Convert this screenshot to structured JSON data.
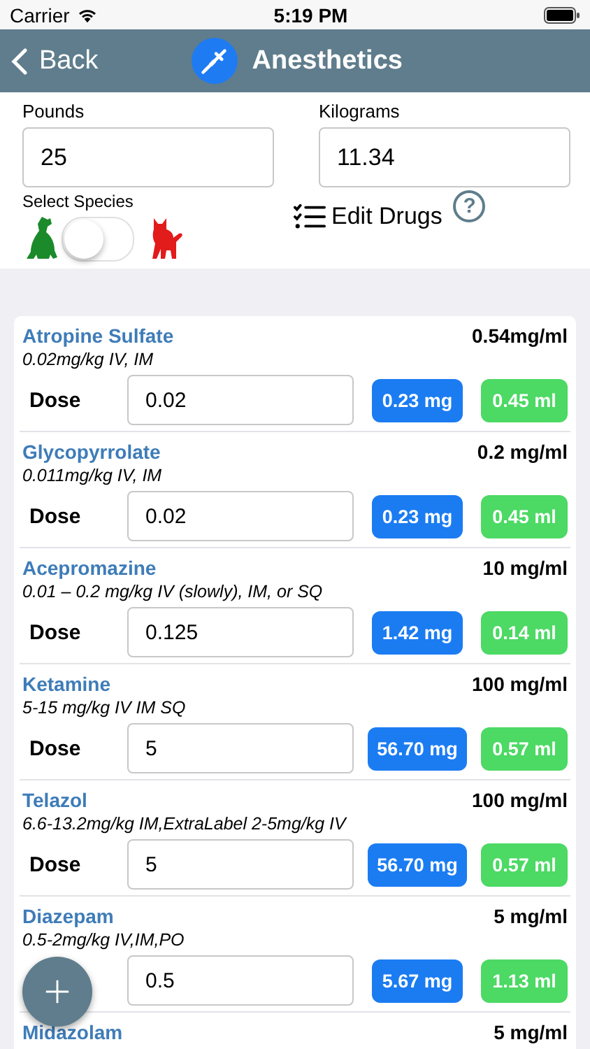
{
  "status_bar": {
    "carrier": "Carrier",
    "time": "5:19 PM"
  },
  "nav": {
    "back": "Back",
    "title": "Anesthetics"
  },
  "weight": {
    "pounds": {
      "label": "Pounds",
      "value": "25"
    },
    "kilograms": {
      "label": "Kilograms",
      "value": "11.34"
    }
  },
  "species": {
    "label": "Select Species",
    "switch_on": false
  },
  "edit_drugs": "Edit Drugs",
  "help": "?",
  "drugs": [
    {
      "name": "Atropine Sulfate",
      "concentration": "0.54mg/ml",
      "dosing": "0.02mg/kg IV, IM",
      "dose_label": "Dose",
      "dose": "0.02",
      "mg": "0.23 mg",
      "ml": "0.45 ml"
    },
    {
      "name": "Glycopyrrolate",
      "concentration": "0.2 mg/ml",
      "dosing": "0.011mg/kg IV, IM",
      "dose_label": "Dose",
      "dose": "0.02",
      "mg": "0.23 mg",
      "ml": "0.45 ml"
    },
    {
      "name": "Acepromazine",
      "concentration": "10 mg/ml",
      "dosing": "0.01 – 0.2 mg/kg IV (slowly), IM, or SQ",
      "dose_label": "Dose",
      "dose": "0.125",
      "mg": "1.42 mg",
      "ml": "0.14 ml"
    },
    {
      "name": "Ketamine",
      "concentration": "100 mg/ml",
      "dosing": "5-15 mg/kg IV IM SQ",
      "dose_label": "Dose",
      "dose": "5",
      "mg": "56.70 mg",
      "ml": "0.57 ml"
    },
    {
      "name": "Telazol",
      "concentration": "100 mg/ml",
      "dosing": "6.6-13.2mg/kg IM,ExtraLabel 2-5mg/kg IV",
      "dose_label": "Dose",
      "dose": "5",
      "mg": "56.70 mg",
      "ml": "0.57 ml"
    },
    {
      "name": "Diazepam",
      "concentration": "5 mg/ml",
      "dosing": "0.5-2mg/kg IV,IM,PO",
      "dose": "0.5",
      "mg": "5.67 mg",
      "ml": "1.13 ml"
    },
    {
      "name": "Midazolam",
      "concentration": "5 mg/ml"
    }
  ]
}
